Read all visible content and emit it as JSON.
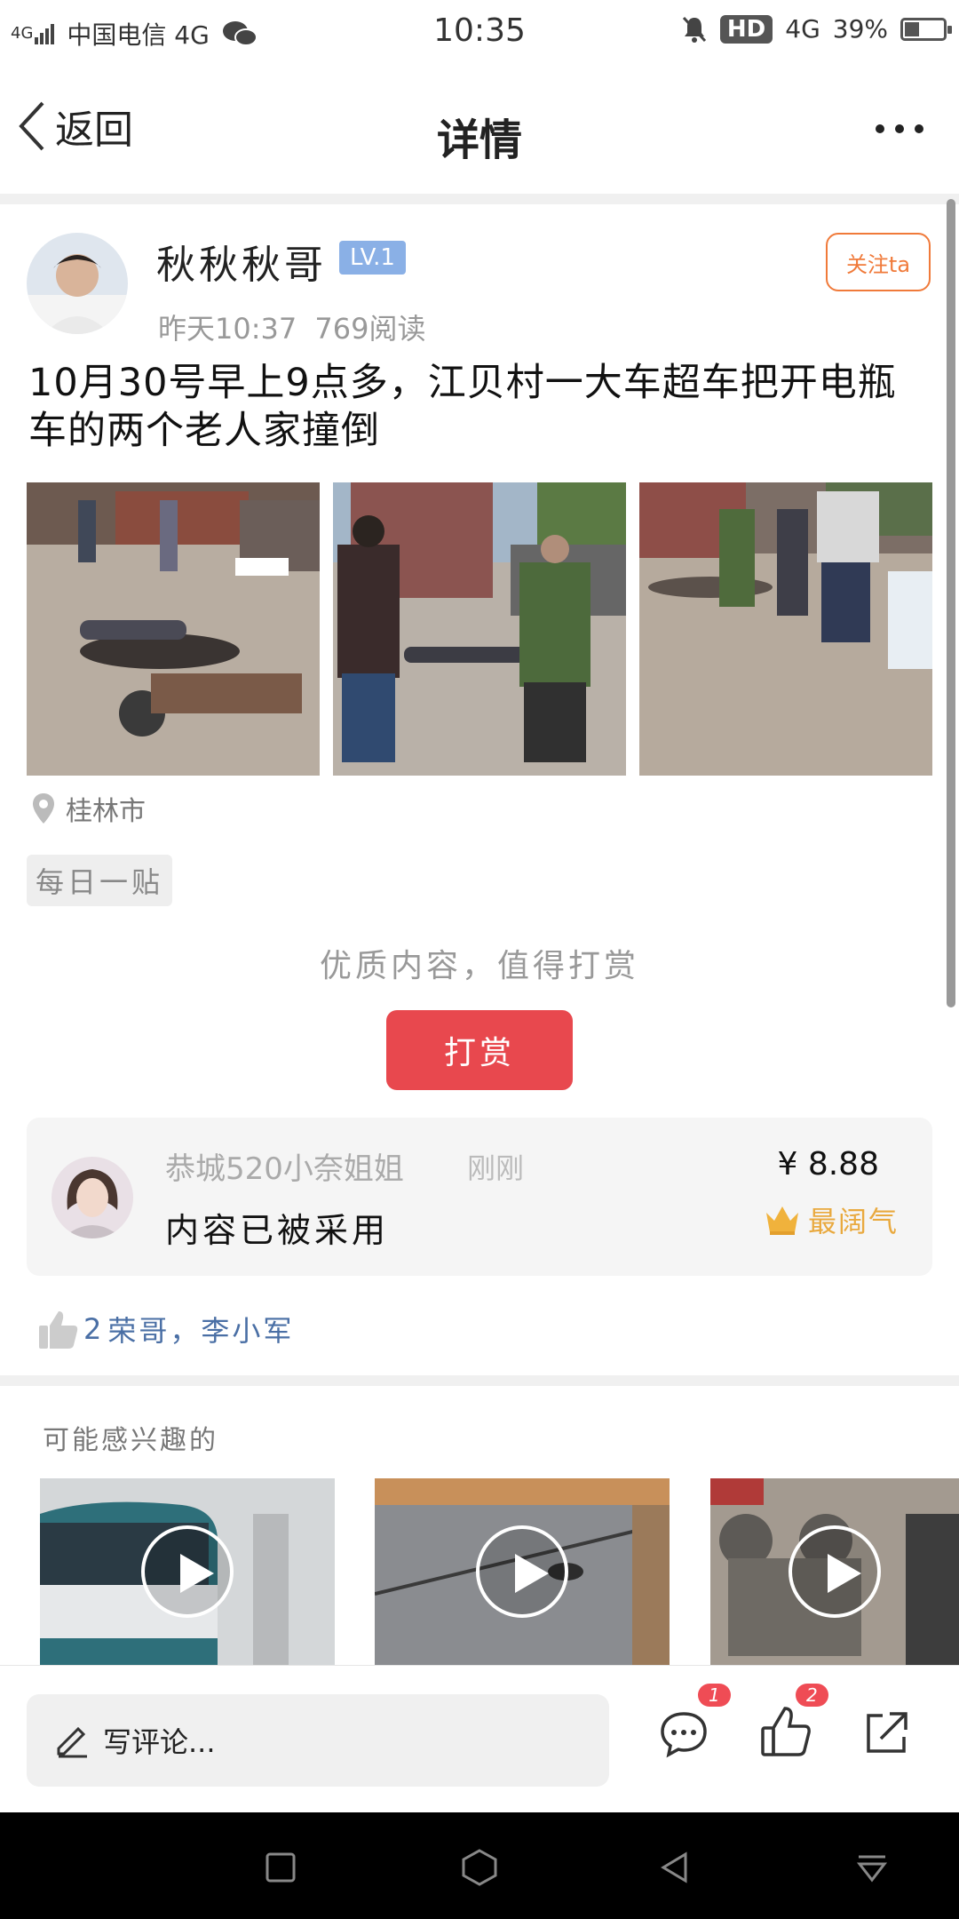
{
  "status_bar": {
    "signal": "4G",
    "carrier": "中国电信 4G",
    "time": "10:35",
    "hd": "HD",
    "network": "4G",
    "battery": "39%"
  },
  "nav": {
    "back_label": "返回",
    "title": "详情"
  },
  "post": {
    "author": "秋秋秋哥",
    "level": "LV.1",
    "time": "昨天10:37",
    "reads": "769阅读",
    "follow_label": "关注ta",
    "title": "10月30号早上9点多，江贝村一大车超车把开电瓶车的两个老人家撞倒",
    "location": "桂林市",
    "tag": "每日一贴"
  },
  "reward": {
    "prompt": "优质内容，值得打赏",
    "button_label": "打赏",
    "giver_name": "恭城520小奈姐姐",
    "giver_time": "刚刚",
    "message": "内容已被采用",
    "amount": "¥ 8.88",
    "badge_label": "最阔气"
  },
  "likes": {
    "count": "2",
    "names": "荣哥，李小军"
  },
  "recommend": {
    "title": "可能感兴趣的"
  },
  "bottom_bar": {
    "comment_placeholder": "写评论...",
    "comment_count": "1",
    "like_count": "2"
  },
  "colors": {
    "accent_red": "#e8484e",
    "follow_orange": "#f07a3a",
    "level_blue": "#8ab0e6",
    "like_names_blue": "#4a6fa5",
    "badge_gold": "#e9a93e"
  }
}
